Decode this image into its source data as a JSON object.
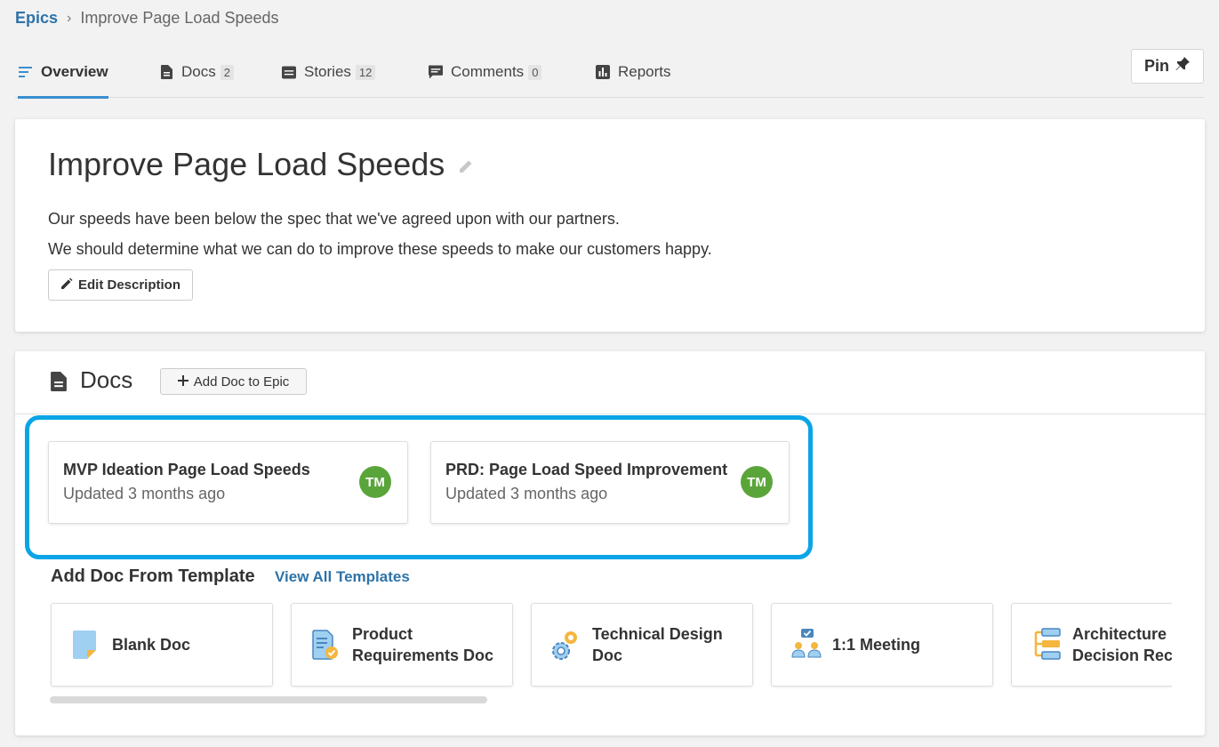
{
  "breadcrumb": {
    "parent": "Epics",
    "current": "Improve Page Load Speeds"
  },
  "tabs": [
    {
      "label": "Overview",
      "count": null,
      "icon": "overview-icon"
    },
    {
      "label": "Docs",
      "count": "2",
      "icon": "doc-icon"
    },
    {
      "label": "Stories",
      "count": "12",
      "icon": "story-icon"
    },
    {
      "label": "Comments",
      "count": "0",
      "icon": "comment-icon"
    },
    {
      "label": "Reports",
      "count": null,
      "icon": "chart-icon"
    }
  ],
  "pin": {
    "label": "Pin"
  },
  "epic": {
    "title": "Improve Page Load Speeds",
    "description_line1": "Our speeds have been below the spec that we've agreed upon with our partners.",
    "description_line2": "We should determine what we can do to improve these speeds to make our customers happy.",
    "edit_description_label": "Edit Description"
  },
  "docs": {
    "title": "Docs",
    "add_label": "Add Doc to Epic",
    "items": [
      {
        "name": "MVP Ideation Page Load Speeds",
        "updated": "Updated 3 months ago",
        "owner_initials": "TM"
      },
      {
        "name": "PRD: Page Load Speed Improvement",
        "updated": "Updated 3 months ago",
        "owner_initials": "TM"
      }
    ]
  },
  "templates": {
    "heading": "Add Doc From Template",
    "view_all": "View All Templates",
    "items": [
      {
        "line1": "Blank Doc",
        "line2": "",
        "icon": "blank-doc-icon"
      },
      {
        "line1": "Product",
        "line2": "Requirements Doc",
        "icon": "requirements-doc-icon"
      },
      {
        "line1": "Technical Design",
        "line2": "Doc",
        "icon": "gears-icon"
      },
      {
        "line1": "1:1 Meeting",
        "line2": "",
        "icon": "meeting-icon"
      },
      {
        "line1": "Architecture",
        "line2": "Decision Reco",
        "icon": "architecture-icon"
      }
    ]
  },
  "colors": {
    "accent": "#3a8fd0",
    "link": "#2e73a8",
    "highlight": "#0aa5e6",
    "avatar": "#5aa53a"
  }
}
